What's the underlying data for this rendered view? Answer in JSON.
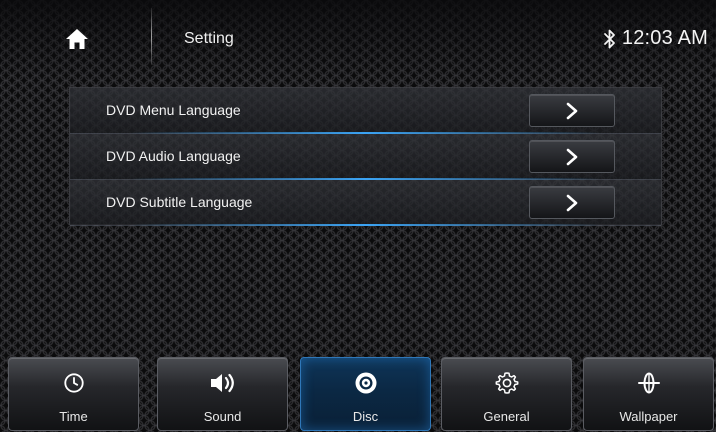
{
  "header": {
    "title": "Setting",
    "time": "12:03 AM",
    "home_icon": "home-icon",
    "bluetooth_icon": "bluetooth-icon"
  },
  "settings": {
    "items": [
      {
        "label": "DVD Menu Language",
        "action_icon": "chevron-right-icon"
      },
      {
        "label": "DVD Audio Language",
        "action_icon": "chevron-right-icon"
      },
      {
        "label": "DVD Subtitle Language",
        "action_icon": "chevron-right-icon"
      }
    ]
  },
  "tabs": {
    "active": "Disc",
    "items": [
      {
        "label": "Time",
        "icon": "clock-icon"
      },
      {
        "label": "Sound",
        "icon": "speaker-icon"
      },
      {
        "label": "Disc",
        "icon": "disc-icon"
      },
      {
        "label": "General",
        "icon": "gear-icon"
      },
      {
        "label": "Wallpaper",
        "icon": "wallpaper-icon"
      }
    ]
  },
  "colors": {
    "accent": "#2f8ee8",
    "active_tab": "#0b2844",
    "text": "#f0f0f0"
  }
}
